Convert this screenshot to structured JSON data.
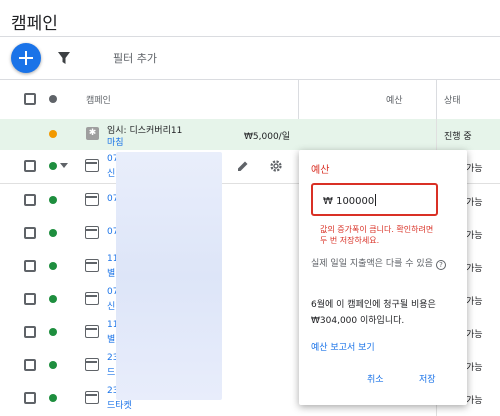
{
  "header": {
    "title": "캠페인"
  },
  "toolbar": {
    "filter_label": "필터 추가"
  },
  "columns": {
    "campaign": "캠페인",
    "budget": "예산",
    "status": "상태"
  },
  "draft_row": {
    "name": "임시: 디스커버리11",
    "sub": "마침",
    "budget": "₩5,000/일",
    "status": "진행 중"
  },
  "rows": [
    {
      "name": "07",
      "sub": "신",
      "status": "가능"
    },
    {
      "name": "07",
      "sub": "",
      "status": "가능"
    },
    {
      "name": "07",
      "sub": "",
      "status": "가능"
    },
    {
      "name": "11",
      "sub": "별",
      "status": "가능"
    },
    {
      "name": "07",
      "sub": "신",
      "status": "가능"
    },
    {
      "name": "11",
      "sub": "별",
      "status": "가능"
    },
    {
      "name": "23",
      "sub": "드",
      "status": "가능"
    },
    {
      "name": "23",
      "sub": "드타켓",
      "status": "가능"
    }
  ],
  "popup": {
    "title": "예산",
    "currency": "₩",
    "value": "100000",
    "error": "값의 증가폭이 큽니다. 확인하려면 두 번 저장하세요.",
    "note": "실제 일일 지출액은 다를 수 있음",
    "summary": "6월에 이 캠페인에 청구될 비용은 ₩304,000 이하입니다.",
    "report_link": "예산 보고서 보기",
    "cancel": "취소",
    "save": "저장"
  },
  "colors": {
    "accent": "#1a73e8",
    "error": "#d93025",
    "active_dot": "#1e8e3e",
    "draft_bg": "#e6f4ea",
    "draft_dot": "#f29900"
  }
}
